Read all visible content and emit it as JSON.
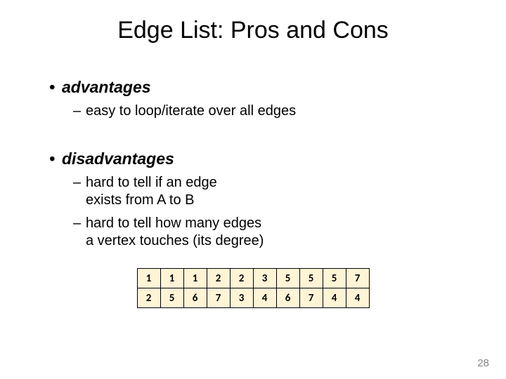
{
  "title": "Edge List: Pros and Cons",
  "advantages": {
    "label": "advantages",
    "items": [
      "easy to loop/iterate over all edges"
    ]
  },
  "disadvantages": {
    "label": "disadvantages",
    "items": [
      "hard to tell if an edge\nexists from A to B",
      "hard to tell how many edges\na vertex touches (its degree)"
    ]
  },
  "chart_data": {
    "type": "table",
    "rows": [
      [
        "1",
        "1",
        "1",
        "2",
        "2",
        "3",
        "5",
        "5",
        "5",
        "7"
      ],
      [
        "2",
        "5",
        "6",
        "7",
        "3",
        "4",
        "6",
        "7",
        "4",
        "4"
      ]
    ]
  },
  "page_number": "28"
}
